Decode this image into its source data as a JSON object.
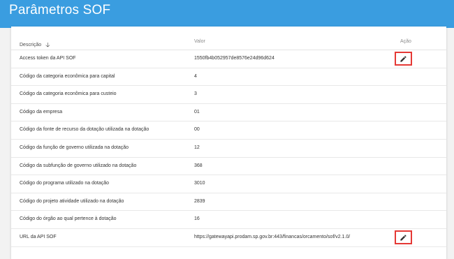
{
  "header": {
    "title": "Parâmetros SOF"
  },
  "table": {
    "columns": {
      "descricao": "Descrição",
      "valor": "Valor",
      "acao": "Ação"
    },
    "rows": [
      {
        "descricao": "Access token da API SOF",
        "valor": "1550fb4b052957de8576e24d96d624"
      },
      {
        "descricao": "Código da categoria econômica para capital",
        "valor": "4"
      },
      {
        "descricao": "Código da categoria econômica para custeio",
        "valor": "3"
      },
      {
        "descricao": "Código da empresa",
        "valor": "01"
      },
      {
        "descricao": "Código da fonte de recurso da dotação utilizada na dotação",
        "valor": "00"
      },
      {
        "descricao": "Código da função de governo utilizada na dotação",
        "valor": "12"
      },
      {
        "descricao": "Código da subfunção de governo utilizado na dotação",
        "valor": "368"
      },
      {
        "descricao": "Código do programa utilizado na dotação",
        "valor": "3010"
      },
      {
        "descricao": "Código do projeto atividade utilizado na dotação",
        "valor": "2839"
      },
      {
        "descricao": "Código do órgão ao qual pertence à dotação",
        "valor": "16"
      },
      {
        "descricao": "URL da API SOF",
        "valor": "https://gatewayapi.prodam.sp.gov.br:443/financas/orcamento/sof/v2.1.0/"
      }
    ],
    "edit_icon": "pencil-icon",
    "highlight_color": "#e53935"
  }
}
